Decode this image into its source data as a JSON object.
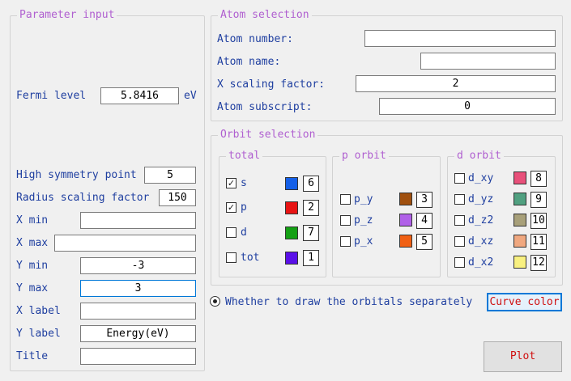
{
  "param": {
    "title": "Parameter input",
    "fermi_label": "Fermi level",
    "fermi_value": "5.8416",
    "fermi_unit": "eV",
    "hsp_label": "High symmetry point",
    "hsp_value": "5",
    "rsf_label": "Radius scaling factor",
    "rsf_value": "150",
    "xmin_label": "X min",
    "xmin_value": "",
    "xmax_label": "X max",
    "xmax_value": "",
    "ymin_label": "Y min",
    "ymin_value": "-3",
    "ymax_label": "Y max",
    "ymax_value": "3",
    "xlabel_label": "X label",
    "xlabel_value": "",
    "ylabel_label": "Y label",
    "ylabel_value": "Energy(eV)",
    "title_label": "Title",
    "title_value": ""
  },
  "atom": {
    "title": "Atom selection",
    "number_label": "Atom number:",
    "number_value": "",
    "name_label": "Atom name:",
    "name_value": "",
    "xscale_label": "X scaling factor:",
    "xscale_value": "2",
    "subscript_label": "Atom subscript:",
    "subscript_value": "0"
  },
  "orbit": {
    "title": "Orbit selection",
    "total": {
      "title": "total",
      "items": [
        {
          "label": "s",
          "checked": true,
          "color": "#1560e8",
          "num": "6"
        },
        {
          "label": "p",
          "checked": true,
          "color": "#e81414",
          "num": "2"
        },
        {
          "label": "d",
          "checked": false,
          "color": "#14a014",
          "num": "7"
        },
        {
          "label": "tot",
          "checked": false,
          "color": "#5a10e8",
          "num": "1"
        }
      ]
    },
    "p": {
      "title": "p orbit",
      "items": [
        {
          "label": "p_y",
          "checked": false,
          "color": "#a0500f",
          "num": "3"
        },
        {
          "label": "p_z",
          "checked": false,
          "color": "#b060e8",
          "num": "4"
        },
        {
          "label": "p_x",
          "checked": false,
          "color": "#f06014",
          "num": "5"
        }
      ]
    },
    "d": {
      "title": "d orbit",
      "items": [
        {
          "label": "d_xy",
          "checked": false,
          "color": "#e8507a",
          "num": "8"
        },
        {
          "label": "d_yz",
          "checked": false,
          "color": "#50a080",
          "num": "9"
        },
        {
          "label": "d_z2",
          "checked": false,
          "color": "#a8a07a",
          "num": "10"
        },
        {
          "label": "d_xz",
          "checked": false,
          "color": "#f0a880",
          "num": "11"
        },
        {
          "label": "d_x2",
          "checked": false,
          "color": "#f8f080",
          "num": "12"
        }
      ]
    }
  },
  "bottom": {
    "separate_label": "Whether to draw the orbitals separately",
    "curve_color_label": "Curve color",
    "plot_label": "Plot"
  },
  "colors": {
    "label": "#1f3fa0",
    "group_title": "#b060d0",
    "button_red": "#d01010",
    "focus": "#0078d7"
  }
}
